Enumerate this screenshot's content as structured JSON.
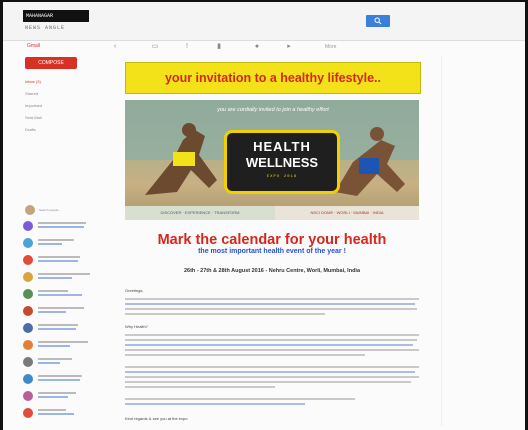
{
  "app": {
    "logo_text": "MAHANAGAR",
    "logo_sub": "NEWS ANGLE"
  },
  "toolbar": {
    "brand": "Gmail",
    "more": "More",
    "icons": [
      "back-icon",
      "archive-icon",
      "report-icon",
      "delete-icon",
      "label-icon",
      "move-icon"
    ]
  },
  "sidebar": {
    "compose_label": "COMPOSE",
    "nav": [
      {
        "label": "Inbox (3)",
        "active": true
      },
      {
        "label": "Starred",
        "active": false
      },
      {
        "label": "Important",
        "active": false
      },
      {
        "label": "Sent Mail",
        "active": false
      },
      {
        "label": "Drafts",
        "active": false
      }
    ],
    "chat_header": "Search people...",
    "contacts": [
      {
        "color": "#7a5cd6"
      },
      {
        "color": "#4da3d6"
      },
      {
        "color": "#e24b3a"
      },
      {
        "color": "#d9a440"
      },
      {
        "color": "#5a8f5a"
      },
      {
        "color": "#c24c2b"
      },
      {
        "color": "#4a6fa8"
      },
      {
        "color": "#e0803a"
      },
      {
        "color": "#7a7a7a"
      },
      {
        "color": "#3f8bc9"
      },
      {
        "color": "#b85f9a"
      },
      {
        "color": "#e24b3a"
      }
    ]
  },
  "email": {
    "banner": "your invitation to a healthy lifestyle..",
    "hero_top": "you are cordially invited to join a healthy effort",
    "hero_logo_line1": "HEALTH",
    "hero_logo_line2": "WELLNESS",
    "hero_logo_sub": "EXPO 2016",
    "hero_strip_left": "DISCOVER · EXPERIENCE · TRANSFORM",
    "hero_strip_right": "NSCI DOME · WORLI · MUMBAI · INDIA",
    "heading": "Mark the calendar for your health",
    "subheading": "the most important health event of the year !",
    "event_line": "26th - 27th & 28th August 2016 - Nehru Centre, Worli, Mumbai, India",
    "para1_label": "Greetings,",
    "para2_label": "Why Health?",
    "footer_label": "Kind regards & see you at the expo"
  },
  "colors": {
    "accent_red": "#d6271d",
    "banner_yellow": "#f3e21a",
    "link_blue": "#2a4fcf",
    "search_blue": "#3b80d8"
  }
}
